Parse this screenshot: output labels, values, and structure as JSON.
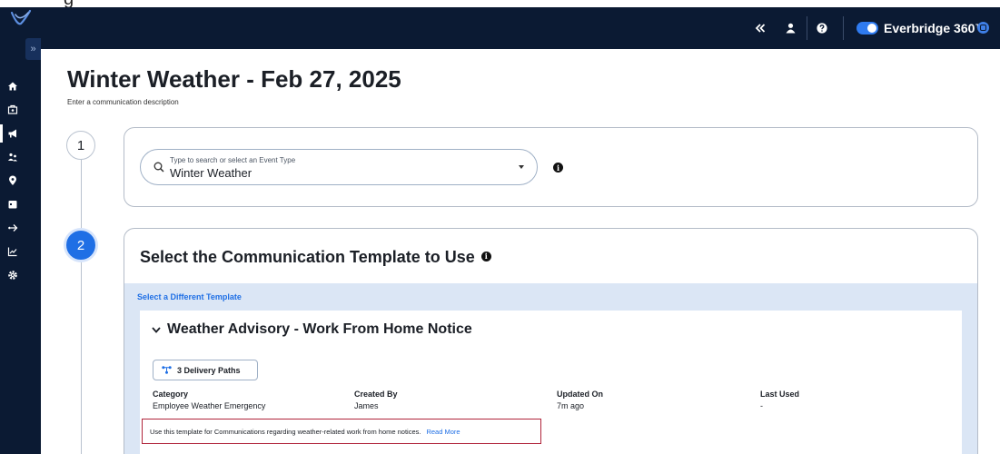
{
  "app": {
    "brand_name": "Everbridge 360™"
  },
  "page": {
    "title": "Winter Weather - Feb 27, 2025",
    "description": "Enter a communication description"
  },
  "topbar": {
    "icons": [
      "collapse-icon",
      "user-icon",
      "help-icon"
    ]
  },
  "sidebar": {
    "expand_label": "»",
    "items": [
      {
        "icon": "home-icon",
        "active": false
      },
      {
        "icon": "incident-icon",
        "active": false
      },
      {
        "icon": "megaphone-icon",
        "active": true
      },
      {
        "icon": "people-icon",
        "active": false
      },
      {
        "icon": "location-pin-icon",
        "active": false
      },
      {
        "icon": "calendar-icon",
        "active": false
      },
      {
        "icon": "flow-icon",
        "active": false
      },
      {
        "icon": "analytics-icon",
        "active": false
      },
      {
        "icon": "settings-icon",
        "active": false
      }
    ]
  },
  "step1": {
    "number": "1",
    "event_type": {
      "placeholder": "Type to search or select an Event Type",
      "value": "Winter Weather"
    }
  },
  "step2": {
    "number": "2",
    "title": "Select the Communication Template to Use",
    "different_template_link": "Select a Different Template",
    "template": {
      "name": "Weather Advisory - Work From Home Notice",
      "delivery_paths": "3 Delivery Paths",
      "category_label": "Category",
      "category_value": "Employee Weather Emergency",
      "created_by_label": "Created By",
      "created_by_value": "James",
      "updated_on_label": "Updated On",
      "updated_on_value": "7m ago",
      "last_used_label": "Last Used",
      "last_used_value": "-",
      "description": "Use this template for Communications regarding weather-related work from home notices.",
      "read_more": "Read More"
    }
  },
  "colors": {
    "nav_bg": "#0b1a33",
    "accent": "#1f6fe5",
    "template_area_bg": "#dbe6f5",
    "highlight_border": "#b0243a"
  }
}
